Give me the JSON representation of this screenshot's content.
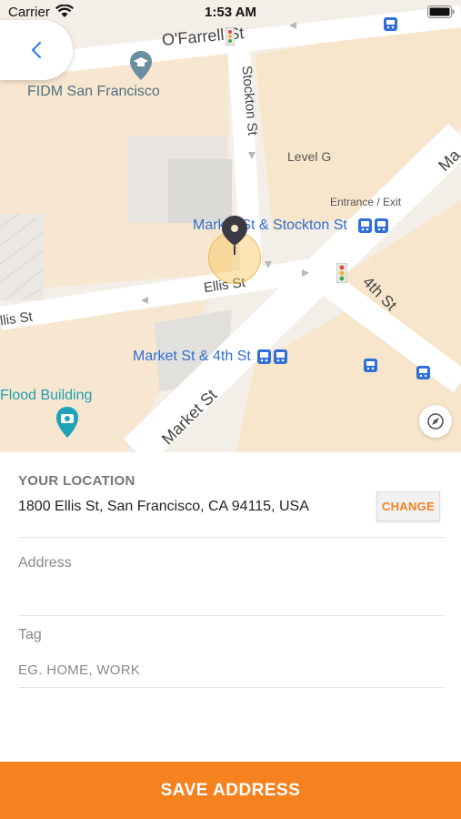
{
  "status_bar": {
    "carrier": "Carrier",
    "time": "1:53 AM"
  },
  "map": {
    "streets": {
      "ofarrell": "O'Farrell St",
      "stockton": "Stockton St",
      "ellis": "Ellis St",
      "ellis_left": "llis St",
      "fourth": "4th St",
      "market": "Market St",
      "market_right": "Ma"
    },
    "places": {
      "fidm": "FIDM San Francisco",
      "level_g": "Level G",
      "entrance_exit": "Entrance / Exit",
      "stop_market_stockton": "Market St & Stockton St",
      "stop_market_4th": "Market St & 4th St",
      "flood_building": "Flood Building"
    },
    "colors": {
      "pin": "#3a3a44",
      "transit": "#2f6fd6",
      "poi_icon": "#1fa3b8"
    }
  },
  "location": {
    "heading": "YOUR LOCATION",
    "address": "1800 Ellis St, San Francisco, CA 94115, USA",
    "change_label": "CHANGE"
  },
  "form": {
    "address_label": "Address",
    "address_value": "",
    "tag_label": "Tag",
    "tag_placeholder": "EG. HOME, WORK"
  },
  "save_label": "SAVE ADDRESS",
  "accent_color": "#f5821f"
}
